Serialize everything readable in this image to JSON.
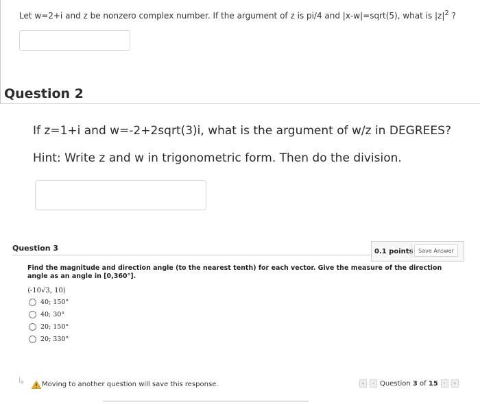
{
  "prev_question": {
    "text_before": "Let w=2+i and z be nonzero complex number.  If the argument of  z  is  pi/4  and  |x-w|=sqrt(5), what is |z|",
    "exponent": "2",
    "text_after": " ?"
  },
  "question2": {
    "title": "Question 2",
    "line1": "If z=1+i and w=-2+2sqrt(3)i,  what is the argument of  w/z  in DEGREES?",
    "line2": "Hint: Write z and w in trigonometric form. Then do the division."
  },
  "question3": {
    "title": "Question 3",
    "points": "0.1 points",
    "save_label": "Save Answer",
    "prompt": "Find the magnitude and direction angle (to the nearest tenth) for each vector. Give the measure of the direction angle as an angle in [0,360°].",
    "vector": "⟨-10√3, 10⟩",
    "options": [
      "40; 150°",
      "40; 30°",
      "20; 150°",
      "20; 330°"
    ]
  },
  "footer": {
    "arrow": "↳",
    "warning_icon": "warning-triangle-icon",
    "message": "Moving to another question will save this response.",
    "nav_prefix": "Question ",
    "current": "3",
    "nav_mid": " of ",
    "total": "15",
    "first_glyph": "«",
    "prev_glyph": "‹",
    "next_glyph": "›",
    "last_glyph": "»"
  }
}
